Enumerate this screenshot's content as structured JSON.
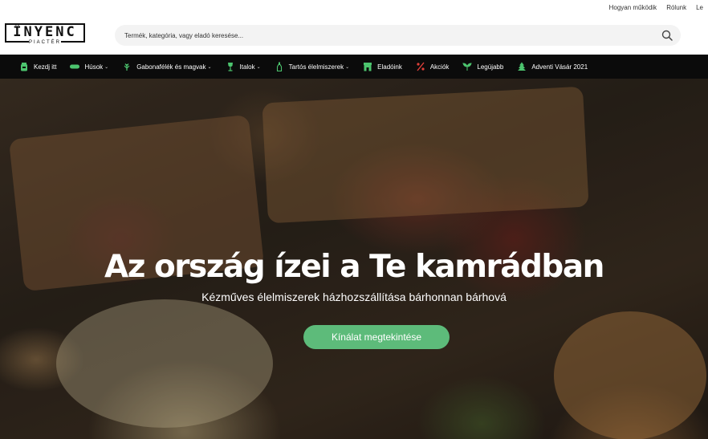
{
  "top_links": [
    "Hogyan működik",
    "Rólunk",
    "Le"
  ],
  "logo": {
    "word": "ÏNYENC",
    "sub": "PIACTÉR"
  },
  "search": {
    "placeholder": "Termék, kategória, vagy eladó keresése...",
    "icon": "search-icon"
  },
  "nav": [
    {
      "label": "Kezdj itt",
      "icon": "jar-icon",
      "dropdown": false
    },
    {
      "label": "Húsok",
      "icon": "sausage-icon",
      "dropdown": true
    },
    {
      "label": "Gabonafélék és magvak",
      "icon": "wheat-icon",
      "dropdown": true
    },
    {
      "label": "Italok",
      "icon": "wine-glass-icon",
      "dropdown": true
    },
    {
      "label": "Tartós élelmiszerek",
      "icon": "bottle-icon",
      "dropdown": true
    },
    {
      "label": "Eladóink",
      "icon": "store-icon",
      "dropdown": false
    },
    {
      "label": "Akciók",
      "icon": "sale-icon",
      "dropdown": false
    },
    {
      "label": "Legújabb",
      "icon": "sprout-icon",
      "dropdown": false
    },
    {
      "label": "Adventi Vásár 2021",
      "icon": "tree-icon",
      "dropdown": false
    }
  ],
  "hero": {
    "title": "Az ország ízei a Te kamrádban",
    "subtitle": "Kézműves élelmiszerek házhozszállítása bárhonnan bárhová",
    "cta": "Kínálat megtekintése"
  },
  "colors": {
    "nav_bg": "#0b0b0b",
    "accent_green": "#5dbb7a",
    "nav_icon_green": "#4cc46e",
    "sale_red": "#e0403a"
  }
}
